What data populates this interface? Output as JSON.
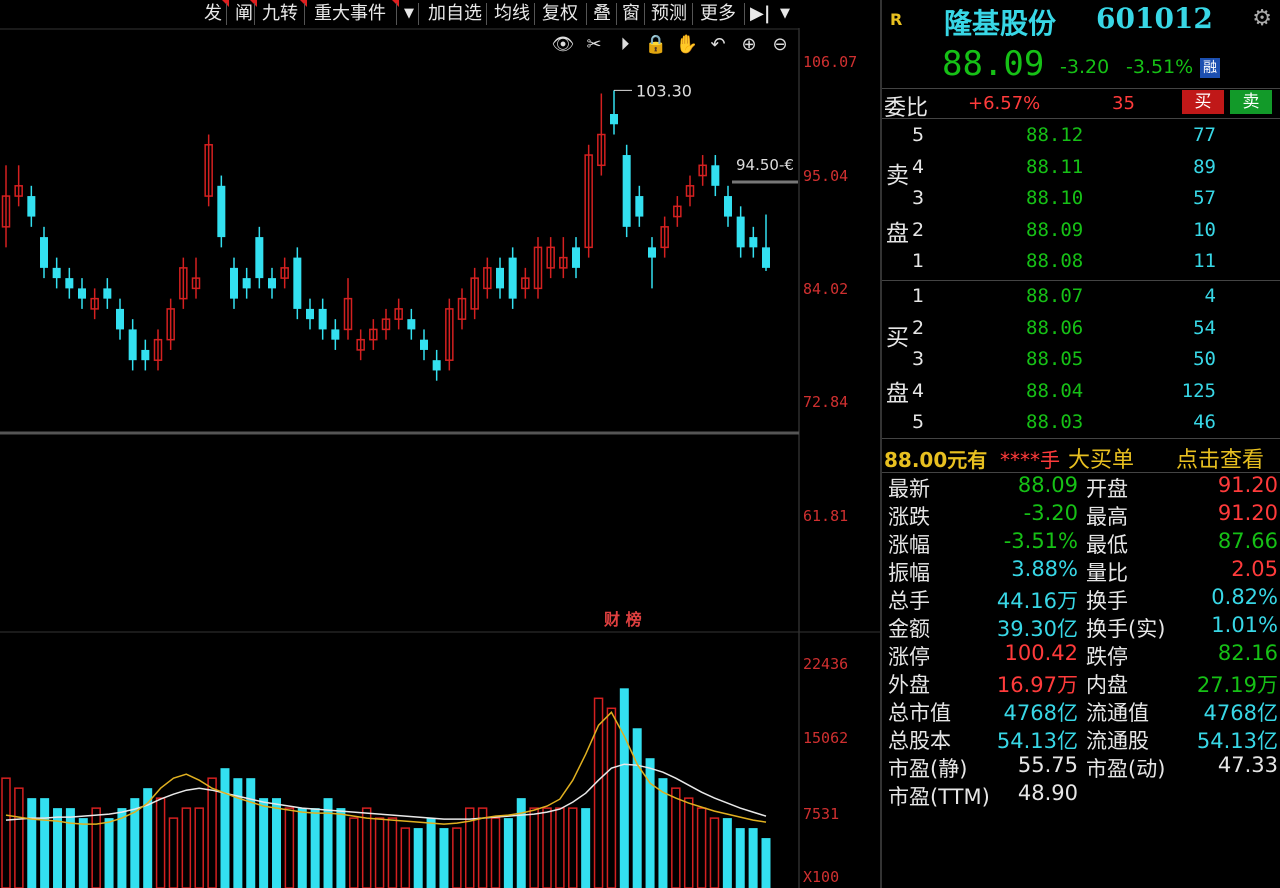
{
  "toolbar": {
    "items": [
      "发",
      "阐",
      "九转",
      "重大事件",
      "加自选",
      "均线",
      "复权",
      "叠",
      "窗",
      "预测",
      "更多"
    ],
    "dropdown_glyph": "▼",
    "collapse_glyph": "▶|"
  },
  "chart_tools": [
    "eye-icon",
    "scissors-icon",
    "play-icon",
    "lock-icon",
    "hand-icon",
    "undo-icon",
    "zoom-in-icon",
    "zoom-out-icon"
  ],
  "price_axis": [
    "106.07",
    "95.04",
    "84.02",
    "72.84",
    "61.81"
  ],
  "volume_axis": [
    "22436",
    "15062",
    "7531",
    "X100"
  ],
  "annotations": {
    "high_label": "103.30",
    "low_label": "94.50-€",
    "volume_tag": "财 榜"
  },
  "chart_data": {
    "type": "candlestick",
    "ylim": [
      61.81,
      106.07
    ],
    "candles": [
      {
        "o": 90,
        "c": 93,
        "h": 96,
        "l": 88
      },
      {
        "o": 93,
        "c": 94,
        "h": 96,
        "l": 92
      },
      {
        "o": 93,
        "c": 91,
        "h": 94,
        "l": 90
      },
      {
        "o": 89,
        "c": 86,
        "h": 90,
        "l": 85
      },
      {
        "o": 86,
        "c": 85,
        "h": 87,
        "l": 84
      },
      {
        "o": 85,
        "c": 84,
        "h": 86,
        "l": 83
      },
      {
        "o": 84,
        "c": 83,
        "h": 85,
        "l": 82
      },
      {
        "o": 82,
        "c": 83,
        "h": 84,
        "l": 81
      },
      {
        "o": 84,
        "c": 83,
        "h": 85,
        "l": 82
      },
      {
        "o": 82,
        "c": 80,
        "h": 83,
        "l": 79
      },
      {
        "o": 80,
        "c": 77,
        "h": 81,
        "l": 76
      },
      {
        "o": 78,
        "c": 77,
        "h": 79,
        "l": 76
      },
      {
        "o": 77,
        "c": 79,
        "h": 80,
        "l": 76
      },
      {
        "o": 79,
        "c": 82,
        "h": 83,
        "l": 78
      },
      {
        "o": 83,
        "c": 86,
        "h": 87,
        "l": 82
      },
      {
        "o": 84,
        "c": 85,
        "h": 87,
        "l": 83
      },
      {
        "o": 93,
        "c": 98,
        "h": 99,
        "l": 92
      },
      {
        "o": 94,
        "c": 89,
        "h": 95,
        "l": 88
      },
      {
        "o": 86,
        "c": 83,
        "h": 87,
        "l": 82
      },
      {
        "o": 85,
        "c": 84,
        "h": 86,
        "l": 83
      },
      {
        "o": 89,
        "c": 85,
        "h": 90,
        "l": 84
      },
      {
        "o": 85,
        "c": 84,
        "h": 86,
        "l": 83
      },
      {
        "o": 85,
        "c": 86,
        "h": 87,
        "l": 84
      },
      {
        "o": 87,
        "c": 82,
        "h": 88,
        "l": 81
      },
      {
        "o": 82,
        "c": 81,
        "h": 83,
        "l": 80
      },
      {
        "o": 82,
        "c": 80,
        "h": 83,
        "l": 79
      },
      {
        "o": 80,
        "c": 79,
        "h": 81,
        "l": 78
      },
      {
        "o": 80,
        "c": 83,
        "h": 85,
        "l": 79
      },
      {
        "o": 78,
        "c": 79,
        "h": 80,
        "l": 77
      },
      {
        "o": 79,
        "c": 80,
        "h": 81,
        "l": 78
      },
      {
        "o": 80,
        "c": 81,
        "h": 82,
        "l": 79
      },
      {
        "o": 81,
        "c": 82,
        "h": 83,
        "l": 80
      },
      {
        "o": 81,
        "c": 80,
        "h": 82,
        "l": 79
      },
      {
        "o": 79,
        "c": 78,
        "h": 80,
        "l": 77
      },
      {
        "o": 77,
        "c": 76,
        "h": 78,
        "l": 75
      },
      {
        "o": 77,
        "c": 82,
        "h": 83,
        "l": 76
      },
      {
        "o": 81,
        "c": 83,
        "h": 84,
        "l": 80
      },
      {
        "o": 82,
        "c": 85,
        "h": 86,
        "l": 81
      },
      {
        "o": 84,
        "c": 86,
        "h": 87,
        "l": 83
      },
      {
        "o": 86,
        "c": 84,
        "h": 87,
        "l": 83
      },
      {
        "o": 87,
        "c": 83,
        "h": 88,
        "l": 82
      },
      {
        "o": 84,
        "c": 85,
        "h": 86,
        "l": 83
      },
      {
        "o": 84,
        "c": 88,
        "h": 89,
        "l": 83
      },
      {
        "o": 86,
        "c": 88,
        "h": 89,
        "l": 85
      },
      {
        "o": 86,
        "c": 87,
        "h": 89,
        "l": 85
      },
      {
        "o": 88,
        "c": 86,
        "h": 89,
        "l": 85
      },
      {
        "o": 88,
        "c": 97,
        "h": 98,
        "l": 87
      },
      {
        "o": 96,
        "c": 99,
        "h": 103,
        "l": 95
      },
      {
        "o": 101,
        "c": 100,
        "h": 103.3,
        "l": 99
      },
      {
        "o": 97,
        "c": 90,
        "h": 98,
        "l": 89
      },
      {
        "o": 93,
        "c": 91,
        "h": 94,
        "l": 90
      },
      {
        "o": 88,
        "c": 87,
        "h": 89,
        "l": 84
      },
      {
        "o": 88,
        "c": 90,
        "h": 91,
        "l": 87
      },
      {
        "o": 91,
        "c": 92,
        "h": 93,
        "l": 90
      },
      {
        "o": 93,
        "c": 94,
        "h": 95,
        "l": 92
      },
      {
        "o": 95,
        "c": 96,
        "h": 97,
        "l": 94
      },
      {
        "o": 96,
        "c": 94,
        "h": 97,
        "l": 93
      },
      {
        "o": 93,
        "c": 91,
        "h": 94,
        "l": 90
      },
      {
        "o": 91,
        "c": 88,
        "h": 92,
        "l": 87
      },
      {
        "o": 89,
        "c": 88,
        "h": 90,
        "l": 87
      },
      {
        "o": 88,
        "c": 86,
        "h": 91.2,
        "l": 85.7
      }
    ],
    "volumes": [
      11,
      10,
      9,
      9,
      8,
      8,
      7,
      8,
      7,
      8,
      9,
      10,
      9,
      7,
      8,
      8,
      11,
      12,
      11,
      11,
      9,
      9,
      8,
      8,
      8,
      9,
      8,
      7,
      8,
      7,
      7,
      6,
      6,
      7,
      6,
      6,
      8,
      8,
      7,
      7,
      9,
      8,
      8,
      8,
      8,
      8,
      19,
      18,
      20,
      16,
      13,
      11,
      10,
      9,
      8,
      7,
      7,
      6,
      6,
      5
    ],
    "ma_yellow": [
      7.3,
      7.1,
      6.9,
      6.8,
      6.7,
      6.5,
      6.4,
      6.4,
      6.6,
      7.0,
      7.6,
      8.5,
      10,
      11,
      11.4,
      10.8,
      10,
      9.5,
      9.0,
      8.6,
      8.2,
      8.0,
      7.8,
      7.6,
      7.5,
      7.5,
      7.4,
      7.2,
      7.0,
      6.9,
      6.8,
      6.7,
      6.6,
      6.5,
      6.4,
      6.5,
      6.7,
      7.0,
      7.2,
      7.3,
      7.5,
      7.8,
      8.2,
      8.9,
      10.8,
      13.4,
      16.3,
      17.6,
      15.2,
      12.4,
      10.5,
      9.6,
      9.0,
      8.5,
      8.1,
      7.7,
      7.4,
      7.1,
      6.8,
      6.6
    ],
    "ma_white": [
      6.8,
      6.9,
      7.0,
      7.0,
      7.1,
      7.1,
      7.2,
      7.3,
      7.4,
      7.6,
      7.9,
      8.3,
      8.9,
      9.4,
      9.8,
      10.0,
      9.8,
      9.5,
      9.2,
      8.9,
      8.6,
      8.4,
      8.2,
      8.0,
      7.9,
      7.8,
      7.7,
      7.6,
      7.5,
      7.4,
      7.3,
      7.2,
      7.1,
      7.0,
      6.9,
      6.9,
      6.9,
      7.0,
      7.1,
      7.2,
      7.3,
      7.4,
      7.6,
      7.9,
      8.6,
      9.5,
      10.8,
      12.0,
      12.4,
      12.3,
      12.0,
      11.6,
      11.0,
      10.3,
      9.6,
      9.0,
      8.5,
      8.0,
      7.6,
      7.2
    ]
  },
  "quote": {
    "r_badge": "R",
    "stock_name": "隆基股份",
    "stock_code": "601012",
    "last_price": "88.09",
    "change": "-3.20",
    "change_pct": "-3.51%",
    "margin_badge": "融",
    "wei_label": "委比",
    "wei_value": "+6.57%",
    "wei_count": "35",
    "buy_button": "买",
    "sell_button": "卖",
    "sell_side_label": [
      "卖",
      "盘"
    ],
    "buy_side_label": [
      "买",
      "盘"
    ],
    "asks": [
      {
        "level": "5",
        "price": "88.12",
        "volume": "77"
      },
      {
        "level": "4",
        "price": "88.11",
        "volume": "89"
      },
      {
        "level": "3",
        "price": "88.10",
        "volume": "57"
      },
      {
        "level": "2",
        "price": "88.09",
        "volume": "10"
      },
      {
        "level": "1",
        "price": "88.08",
        "volume": "11"
      }
    ],
    "bids": [
      {
        "level": "1",
        "price": "88.07",
        "volume": "4"
      },
      {
        "level": "2",
        "price": "88.06",
        "volume": "54"
      },
      {
        "level": "3",
        "price": "88.05",
        "volume": "50"
      },
      {
        "level": "4",
        "price": "88.04",
        "volume": "125"
      },
      {
        "level": "5",
        "price": "88.03",
        "volume": "46"
      }
    ],
    "big_order": {
      "price_text": "88.00元有",
      "stars": "****手",
      "label": "大买单",
      "link": "点击查看"
    },
    "stats": [
      {
        "l1": "最新",
        "v1": "88.09",
        "c1": "green",
        "l2": "开盘",
        "v2": "91.20",
        "c2": "red"
      },
      {
        "l1": "涨跌",
        "v1": "-3.20",
        "c1": "green",
        "l2": "最高",
        "v2": "91.20",
        "c2": "red"
      },
      {
        "l1": "涨幅",
        "v1": "-3.51%",
        "c1": "green",
        "l2": "最低",
        "v2": "87.66",
        "c2": "green"
      },
      {
        "l1": "振幅",
        "v1": "3.88%",
        "c1": "cyan",
        "l2": "量比",
        "v2": "2.05",
        "c2": "red"
      },
      {
        "l1": "总手",
        "v1": "44.16万",
        "c1": "cyan",
        "l2": "换手",
        "v2": "0.82%",
        "c2": "cyan"
      },
      {
        "l1": "金额",
        "v1": "39.30亿",
        "c1": "cyan",
        "l2": "换手(实)",
        "v2": "1.01%",
        "c2": "cyan"
      },
      {
        "l1": "涨停",
        "v1": "100.42",
        "c1": "red",
        "l2": "跌停",
        "v2": "82.16",
        "c2": "green"
      },
      {
        "l1": "外盘",
        "v1": "16.97万",
        "c1": "red",
        "l2": "内盘",
        "v2": "27.19万",
        "c2": "green"
      },
      {
        "l1": "总市值",
        "v1": "4768亿",
        "c1": "cyan",
        "l2": "流通值",
        "v2": "4768亿",
        "c2": "cyan"
      },
      {
        "l1": "总股本",
        "v1": "54.13亿",
        "c1": "cyan",
        "l2": "流通股",
        "v2": "54.13亿",
        "c2": "cyan"
      },
      {
        "l1": "市盈(静)",
        "v1": "55.75",
        "c1": "white",
        "l2": "市盈(动)",
        "v2": "47.33",
        "c2": "white"
      },
      {
        "l1": "市盈(TTM)",
        "v1": "48.90",
        "c1": "white",
        "l2": "",
        "v2": "",
        "c2": "white"
      }
    ]
  },
  "colors": {
    "up": "#d42020",
    "down": "#33e0f0",
    "ma_yellow": "#e0b020",
    "ma_white": "#e8e8e8"
  }
}
